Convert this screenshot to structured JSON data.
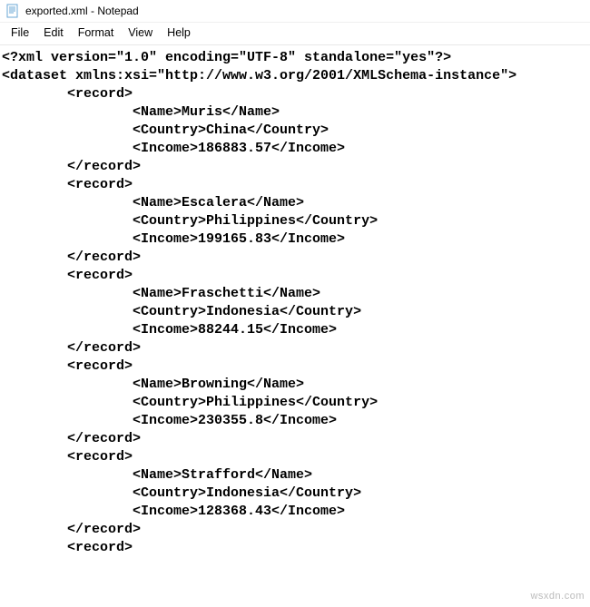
{
  "window": {
    "title": "exported.xml - Notepad"
  },
  "menu": {
    "file": "File",
    "edit": "Edit",
    "format": "Format",
    "view": "View",
    "help": "Help"
  },
  "xml": {
    "declaration": {
      "version": "1.0",
      "encoding": "UTF-8",
      "standalone": "yes"
    },
    "root_tag": "dataset",
    "root_attrs": "xmlns:xsi=\"http://www.w3.org/2001/XMLSchema-instance\"",
    "record_tag": "record",
    "fields": [
      "Name",
      "Country",
      "Income"
    ],
    "records": [
      {
        "Name": "Muris",
        "Country": "China",
        "Income": "186883.57"
      },
      {
        "Name": "Escalera",
        "Country": "Philippines",
        "Income": "199165.83"
      },
      {
        "Name": "Fraschetti",
        "Country": "Indonesia",
        "Income": "88244.15"
      },
      {
        "Name": "Browning",
        "Country": "Philippines",
        "Income": "230355.8"
      },
      {
        "Name": "Strafford",
        "Country": "Indonesia",
        "Income": "128368.43"
      }
    ],
    "trailing_open_record": true
  },
  "watermark": "wsxdn.com"
}
